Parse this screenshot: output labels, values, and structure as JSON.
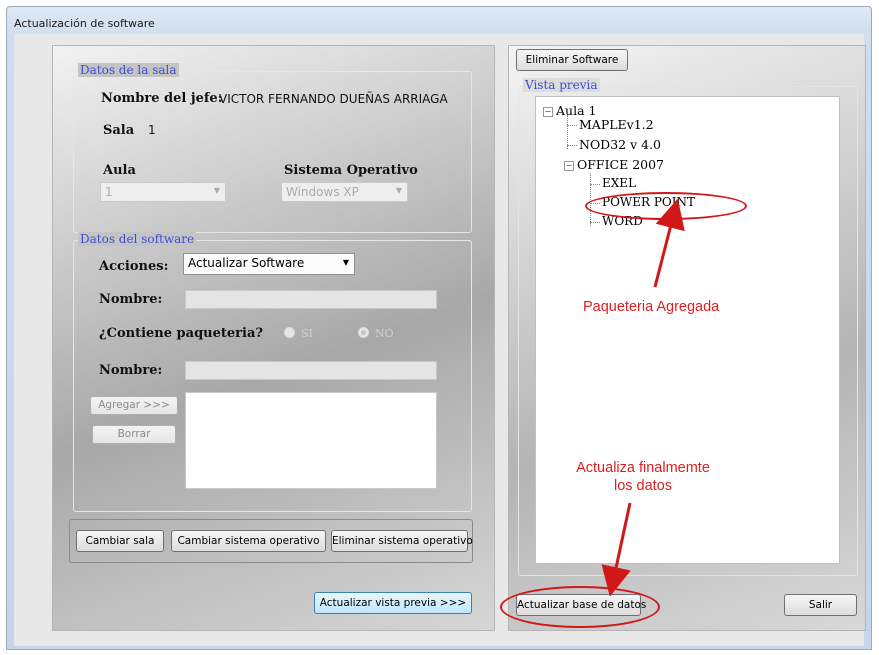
{
  "window": {
    "title": "Actualización de software"
  },
  "sala_group": {
    "legend": "Datos de la sala",
    "jefe_label": "Nombre del jefe:",
    "jefe_value": "VICTOR FERNANDO DUEÑAS ARRIAGA",
    "sala_label": "Sala",
    "sala_value": "1",
    "aula_label": "Aula",
    "aula_value": "1",
    "so_label": "Sistema Operativo",
    "so_value": "Windows XP"
  },
  "software_group": {
    "legend": "Datos del software",
    "acciones_label": "Acciones:",
    "acciones_value": "Actualizar Software",
    "nombre_label": "Nombre:",
    "contiene_label": "¿Contiene paqueteria?",
    "radio_si": "SI",
    "radio_no": "NO",
    "nombre2_label": "Nombre:",
    "agregar_button": "Agregar >>>",
    "borrar_button": "Borrar"
  },
  "bottom_buttons": {
    "cambiar_sala": "Cambiar sala",
    "cambiar_so": "Cambiar sistema operativo",
    "eliminar_so": "Eliminar sistema operativo",
    "actualizar_vista": "Actualizar vista previa >>>"
  },
  "right_panel": {
    "eliminar_software": "Eliminar Software",
    "vista_previa_label": "Vista previa",
    "tree": {
      "root": "Aula 1",
      "items": [
        "MAPLEv1.2",
        "NOD32 v 4.0"
      ],
      "office": "OFFICE 2007",
      "office_children": [
        "EXEL",
        "POWER POINT",
        "WORD"
      ]
    },
    "actualizar_bd": "Actualizar base de datos",
    "salir": "Salir"
  },
  "annotations": {
    "paqueteria": "Paqueteria Agregada",
    "actualiza_line1": "Actualiza finalmemte",
    "actualiza_line2": "los datos",
    "color": "#e02020"
  }
}
